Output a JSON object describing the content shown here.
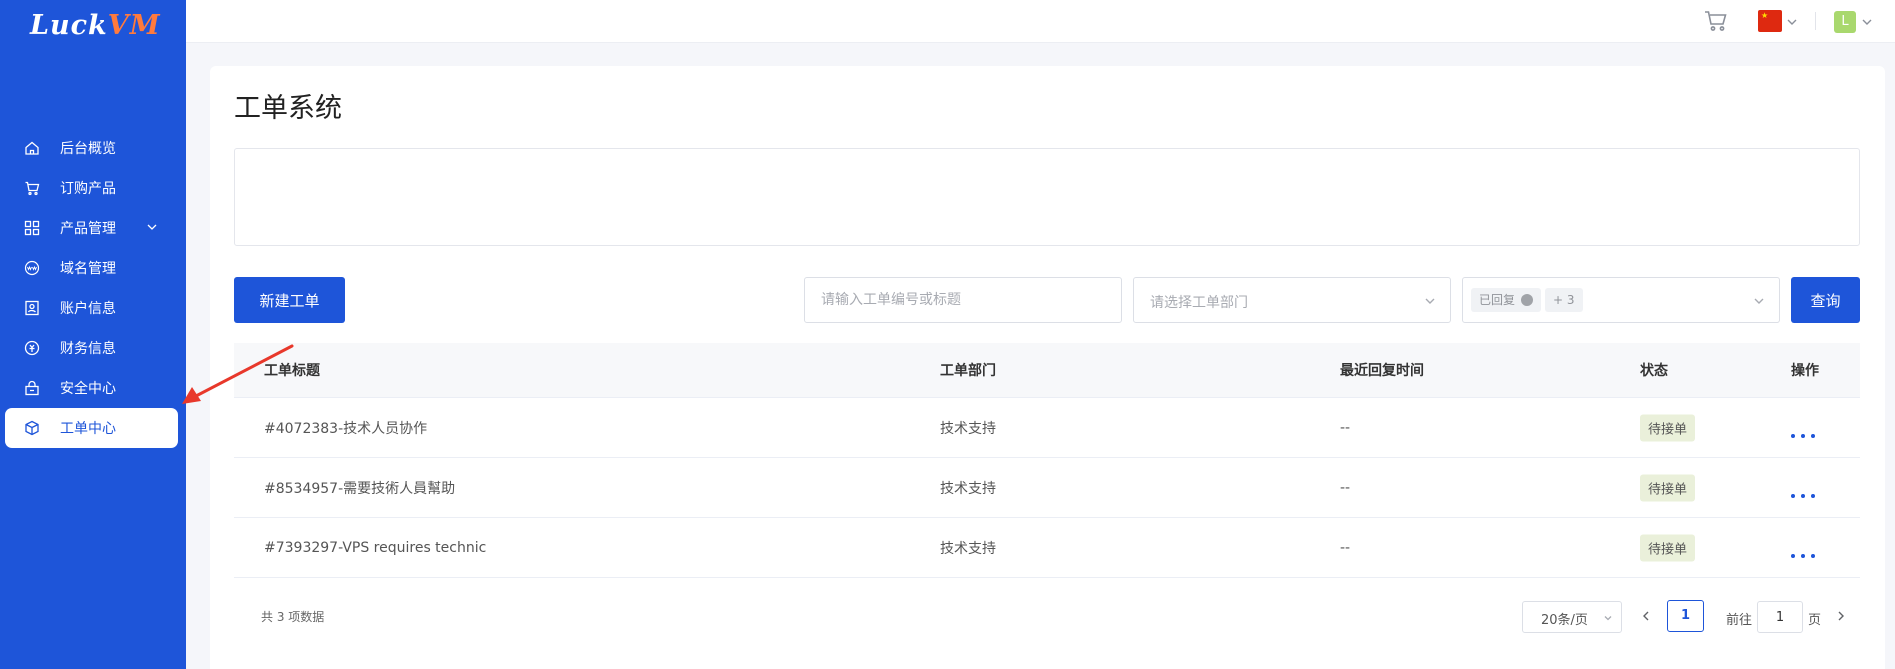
{
  "brand": {
    "logo_main": "Luck",
    "logo_accent": "VM"
  },
  "sidebar": {
    "items": [
      {
        "label": "后台概览",
        "icon": "home-icon"
      },
      {
        "label": "订购产品",
        "icon": "cart-icon"
      },
      {
        "label": "产品管理",
        "icon": "grid-icon",
        "has_children": true
      },
      {
        "label": "域名管理",
        "icon": "www-icon"
      },
      {
        "label": "账户信息",
        "icon": "user-card-icon"
      },
      {
        "label": "财务信息",
        "icon": "coin-icon"
      },
      {
        "label": "安全中心",
        "icon": "lock-icon"
      },
      {
        "label": "工单中心",
        "icon": "cube-icon",
        "active": true
      }
    ]
  },
  "topbar": {
    "avatar_letter": "L",
    "flag_glyph": "★",
    "flag_color": "#de2910"
  },
  "page": {
    "title": "工单系统",
    "new_button": "新建工单",
    "search_placeholder": "请输入工单编号或标题",
    "dept_placeholder": "请选择工单部门",
    "status_tag": "已回复",
    "status_more": "+ 3",
    "query_button": "查询"
  },
  "table": {
    "headers": [
      "工单标题",
      "工单部门",
      "最近回复时间",
      "状态",
      "操作"
    ],
    "rows": [
      {
        "title": "#4072383-技术人员协作",
        "dept": "技术支持",
        "time": "--",
        "status": "待接单"
      },
      {
        "title": "#8534957-需要技術人員幫助",
        "dept": "技术支持",
        "time": "--",
        "status": "待接单"
      },
      {
        "title": "#7393297-VPS requires technic",
        "dept": "技术支持",
        "time": "--",
        "status": "待接单"
      }
    ]
  },
  "pagination": {
    "total_text": "共 3 项数据",
    "page_size": "20条/页",
    "current_page": "1",
    "goto_label": "前往",
    "goto_value": "1",
    "goto_unit": "页"
  },
  "colors": {
    "primary": "#1e55d9",
    "accent": "#ff7a3d",
    "badge_bg": "#eaf0da",
    "badge_text": "#7b9a2d",
    "annotation": "#e8382b"
  }
}
